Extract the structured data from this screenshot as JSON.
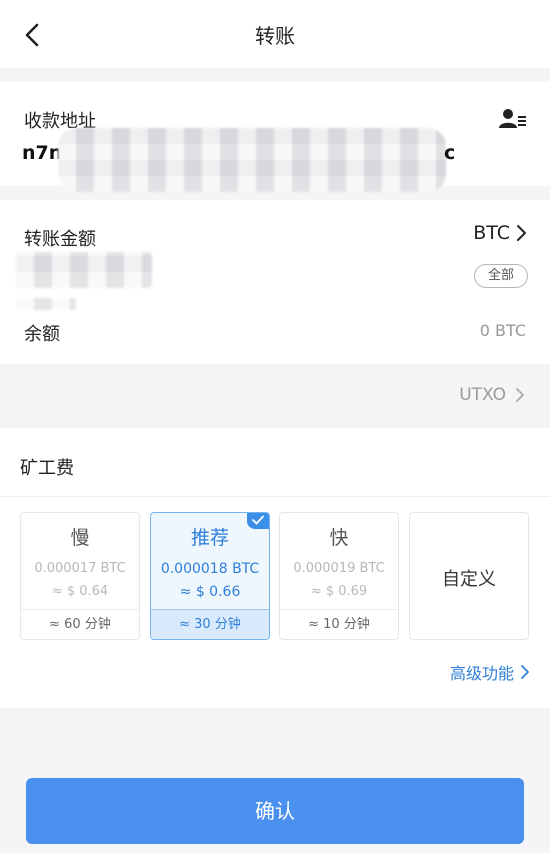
{
  "header": {
    "title": "转账",
    "back_icon": "chevron-left-icon"
  },
  "address": {
    "label": "收款地址",
    "value_start": "n7na",
    "value_end": "c",
    "contact_icon": "address-book-icon"
  },
  "amount": {
    "label": "转账金额",
    "unit": "BTC",
    "all_label": "全部",
    "balance_label": "余额",
    "balance_value": "0 BTC"
  },
  "utxo": {
    "label": "UTXO"
  },
  "fee": {
    "title": "矿工费",
    "options": [
      {
        "name": "慢",
        "btc": "0.000017 BTC",
        "usd": "≈ $ 0.64",
        "time": "≈ 60 分钟"
      },
      {
        "name": "推荐",
        "btc": "0.000018 BTC",
        "usd": "≈ $ 0.66",
        "time": "≈ 30 分钟",
        "selected": true
      },
      {
        "name": "快",
        "btc": "0.000019 BTC",
        "usd": "≈ $ 0.69",
        "time": "≈ 10 分钟"
      },
      {
        "name": "自定义"
      }
    ],
    "advanced": "高级功能"
  },
  "confirm": {
    "label": "确认"
  },
  "colors": {
    "accent": "#4a90ee",
    "selected_bg": "#eef6fe",
    "muted": "#b8b8b8"
  }
}
